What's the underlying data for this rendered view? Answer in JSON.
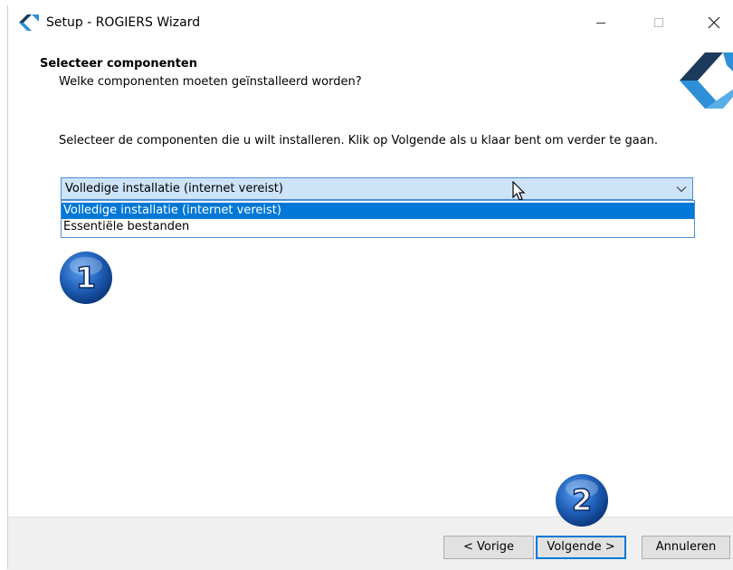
{
  "window": {
    "title": "Setup - ROGIERS Wizard"
  },
  "header": {
    "title": "Selecteer componenten",
    "subtitle": "Welke componenten moeten geïnstalleerd worden?"
  },
  "main": {
    "instructions": "Selecteer de componenten die u wilt installeren. Klik op Volgende als u klaar bent om verder te gaan.",
    "components_select": {
      "selected": "Volledige installatie   (internet vereist)",
      "options": [
        "Volledige installatie   (internet vereist)",
        "Essentiële bestanden"
      ]
    }
  },
  "annotations": {
    "step1": "1",
    "step2": "2"
  },
  "footer": {
    "back_label": "< Vorige",
    "next_label": "Volgende >",
    "cancel_label": "Annuleren"
  },
  "colors": {
    "accent": "#0078d7",
    "combo_bg": "#cde3f8",
    "footer_bg": "#f0f0f0",
    "logo_dark": "#1b3a5c",
    "logo_light": "#2e8fd6",
    "badge_blue": "#1f5fb8"
  },
  "icons": {
    "title_icon": "rogiers-logo-icon",
    "minimize": "minimize-icon",
    "maximize": "maximize-icon",
    "close": "close-icon",
    "dropdown": "chevron-down-icon",
    "cursor": "mouse-pointer-icon"
  }
}
